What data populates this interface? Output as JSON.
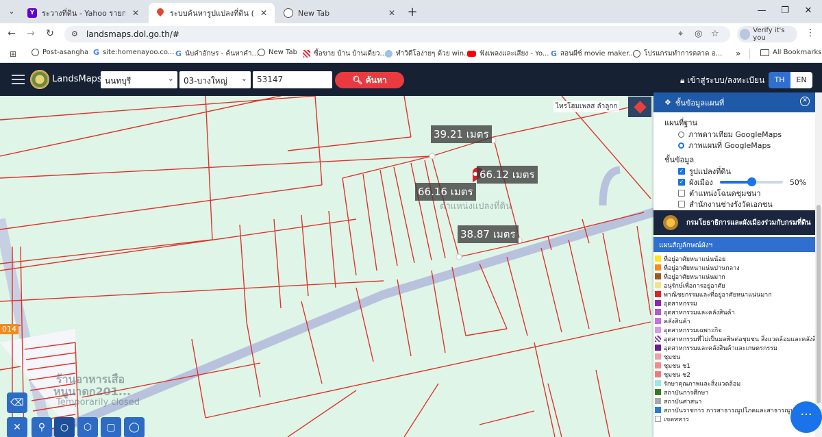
{
  "browser": {
    "tabs": [
      {
        "title": "ระวางที่ดิน - Yahoo รายการที่ค้นพบ",
        "icon": "yahoo-icon",
        "active": false
      },
      {
        "title": "ระบบค้นหารูปแปลงที่ดิน (LandsMap",
        "icon": "map-pin-icon",
        "active": true
      },
      {
        "title": "New Tab",
        "icon": "globe-icon",
        "active": false
      }
    ],
    "url": "landsmaps.dol.go.th/#",
    "profile_label": "Verify it's you",
    "bookmarks": [
      "Post-asangha",
      "site:homenayoo.co...",
      "นับคำอักษร - ค้นหาคำ...",
      "New Tab",
      "ซื้อขาย บ้าน บ้านเดี่ยว...",
      "ทำวิดีโอง่ายๆ ด้วย win...",
      "ฟังเพลงและเสียง - Yo...",
      "สอนผีซ์ movie maker...",
      "โปรแกรมทำการตลาด อ..."
    ],
    "all_bookmarks": "All Bookmarks"
  },
  "app": {
    "brand": "LandsMaps",
    "province": "นนทบุรี",
    "district": "03-บางใหญ่",
    "parcel_no": "53147",
    "search_label": "ค้นหา",
    "login_label": "เข้าสู่ระบบ/ลงทะเบียน",
    "lang_th": "TH",
    "lang_en": "EN"
  },
  "map": {
    "measurements": [
      "39.21 เมตร",
      "66.12 เมตร",
      "66.16 เมตร",
      "38.87 เมตร"
    ],
    "place_label": "ไทรโฮมเพลส ลำลูกก",
    "parcel_label": "ตำแหน่งแปลงที่ดิน",
    "faded_place_1": "ร้านอาหารเสือ",
    "faded_place_2": "หนูนาดก201...",
    "faded_status": "Temporarily closed",
    "road_tag": "014"
  },
  "layer_panel": {
    "title": "ชั้นข้อมูลแผนที่",
    "basemap_title": "แผนที่ฐาน",
    "basemaps": [
      {
        "label": "ภาพดาวเทียม GoogleMaps",
        "selected": false
      },
      {
        "label": "ภาพแผนที่ GoogleMaps",
        "selected": true
      }
    ],
    "layers_title": "ชั้นข้อมูล",
    "layers": [
      {
        "label": "รูปแปลงที่ดิน",
        "checked": true
      },
      {
        "label": "ผังเมือง",
        "checked": true,
        "opacity": "50%",
        "opacity_value": 0.5
      },
      {
        "label": "ตำแหน่งโฉนดชุมชนา",
        "checked": false
      },
      {
        "label": "สำนักงานช่างรังวัดเอกชน",
        "checked": false
      }
    ],
    "banner": "กรมโยธาธิการและผังเมืองร่วมกับกรมที่ดิน",
    "legend_title": "แผนสัญลักษณ์ผังฯ",
    "legend": [
      {
        "label": "ที่อยู่อาศัยหนาแน่นน้อย",
        "color": "#ffe51a"
      },
      {
        "label": "ที่อยู่อาศัยหนาแน่นปานกลาง",
        "color": "#f28c1c"
      },
      {
        "label": "ที่อยู่อาศัยหนาแน่นมาก",
        "color": "#9e5a1e"
      },
      {
        "label": "อนุรักษ์เพื่อการอยู่อาศัย",
        "color": "#f2e28a"
      },
      {
        "label": "พาณิชยกรรมและที่อยู่อาศัยหนาแน่นมาก",
        "color": "#e0241c"
      },
      {
        "label": "อุตสาหกรรม",
        "color": "#8a2bb8"
      },
      {
        "label": "อุตสาหกรรมและคลังสินค้า",
        "color": "#b05ad6"
      },
      {
        "label": "คลังสินค้า",
        "color": "#c86ee6"
      },
      {
        "label": "อุตสาหกรรมเฉพาะกิจ",
        "color": "#d69ae6"
      },
      {
        "label": "อุตสาหกรรมที่ไม่เป็นมลพิษต่อชุมชน สิ่งแวดล้อมและคลังสินค้",
        "color": "#7a2aa8"
      },
      {
        "label": "อุตสาหกรรมและคลังสินค้าและเกษตรกรรม",
        "color": "#6a1e90"
      },
      {
        "label": "ชุมชน",
        "color": "#f0a0a0"
      },
      {
        "label": "ชุมชน ช1",
        "color": "#f28a8a"
      },
      {
        "label": "ชุมชน ช2",
        "color": "#f07a7a"
      },
      {
        "label": "รักษาคุณภาพและสิ่งแวดล้อม",
        "color": "#9ce8e4"
      },
      {
        "label": "สถาบันการศึกษา",
        "color": "#3a7a1e"
      },
      {
        "label": "สถาบันศาสนา",
        "color": "#a8a8a8"
      },
      {
        "label": "สถาบันราชการ การสาธารณูปโภคและสาธารณูปก",
        "color": "#2a7ad0"
      },
      {
        "label": "เขตทหาร",
        "color": "#ffffff"
      }
    ]
  },
  "tools": [
    "eraser-icon",
    "measure-icon",
    "pin-icon",
    "circle-icon",
    "polygon-icon",
    "rectangle-icon",
    "ellipse-icon"
  ]
}
